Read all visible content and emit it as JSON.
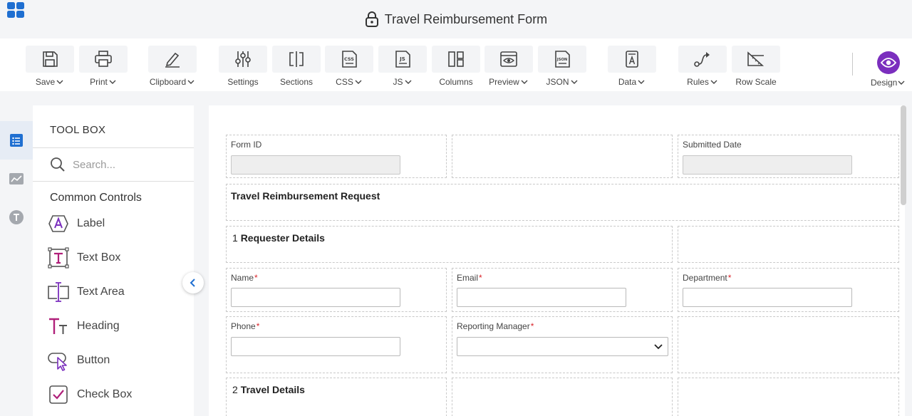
{
  "app": {
    "title": "Travel Reimbursement Form"
  },
  "colors": {
    "accent_purple": "#7b2fbe",
    "brand_blue": "#1f6fd1",
    "required_red": "#d9242a"
  },
  "toolbar": {
    "save": "Save",
    "print": "Print",
    "clipboard": "Clipboard",
    "settings": "Settings",
    "sections": "Sections",
    "css": "CSS",
    "js": "JS",
    "columns": "Columns",
    "preview": "Preview",
    "json": "JSON",
    "data": "Data",
    "rules": "Rules",
    "row_scale": "Row Scale",
    "design": "Design",
    "css_icon_text": "CSS",
    "js_icon_text": "JS",
    "json_icon_text": "JSON"
  },
  "toolbox": {
    "title": "TOOL BOX",
    "search_placeholder": "Search...",
    "section": "Common Controls",
    "items": [
      {
        "label": "Label",
        "icon": "label-icon"
      },
      {
        "label": "Text Box",
        "icon": "text-box-icon"
      },
      {
        "label": "Text Area",
        "icon": "text-area-icon"
      },
      {
        "label": "Heading",
        "icon": "heading-icon"
      },
      {
        "label": "Button",
        "icon": "button-icon"
      },
      {
        "label": "Check Box",
        "icon": "check-box-icon"
      }
    ]
  },
  "form": {
    "form_id_label": "Form ID",
    "submitted_date_label": "Submitted Date",
    "heading": "Travel Reimbursement Request",
    "section1_num": "1",
    "section1_title": "Requester Details",
    "name_label": "Name",
    "email_label": "Email",
    "department_label": "Department",
    "phone_label": "Phone",
    "manager_label": "Reporting Manager",
    "section2_num": "2",
    "section2_title": "Travel Details",
    "required_mark": "*"
  }
}
